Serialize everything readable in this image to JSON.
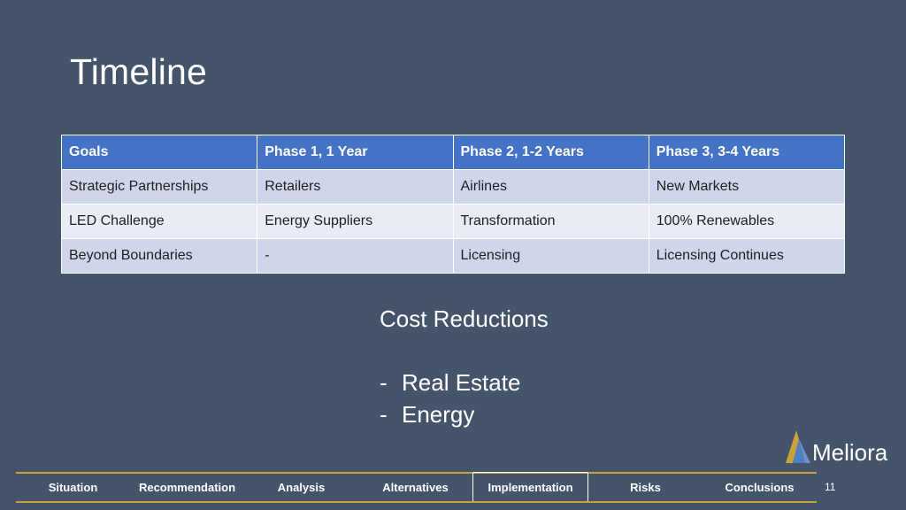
{
  "slide": {
    "title": "Timeline"
  },
  "table": {
    "headers": [
      "Goals",
      "Phase 1,  1 Year",
      "Phase 2,  1-2 Years",
      "Phase 3,  3-4 Years"
    ],
    "rows": [
      [
        "Strategic Partnerships",
        "Retailers",
        "Airlines",
        "New Markets"
      ],
      [
        "LED Challenge",
        "Energy Suppliers",
        "Transformation",
        "100% Renewables"
      ],
      [
        "Beyond Boundaries",
        "-",
        "Licensing",
        "Licensing Continues"
      ]
    ]
  },
  "cost": {
    "heading": "Cost Reductions",
    "items": [
      {
        "dash": "-",
        "text": "Real Estate"
      },
      {
        "dash": "-",
        "text": "Energy"
      }
    ]
  },
  "logo": {
    "text": "Meliora",
    "icon": "meliora-logo-icon",
    "colors": {
      "gold": "#c9a33a",
      "blue": "#4f7fc4"
    }
  },
  "nav": {
    "items": [
      "Situation",
      "Recommendation",
      "Analysis",
      "Alternatives",
      "Implementation",
      "Risks",
      "Conclusions"
    ],
    "active": "Implementation"
  },
  "page_number": "11",
  "colors": {
    "background": "#44546a",
    "header": "#4472c4",
    "row_dark": "#cfd5ea",
    "row_light": "#e9ebf5",
    "nav_line": "#c9a33a"
  }
}
